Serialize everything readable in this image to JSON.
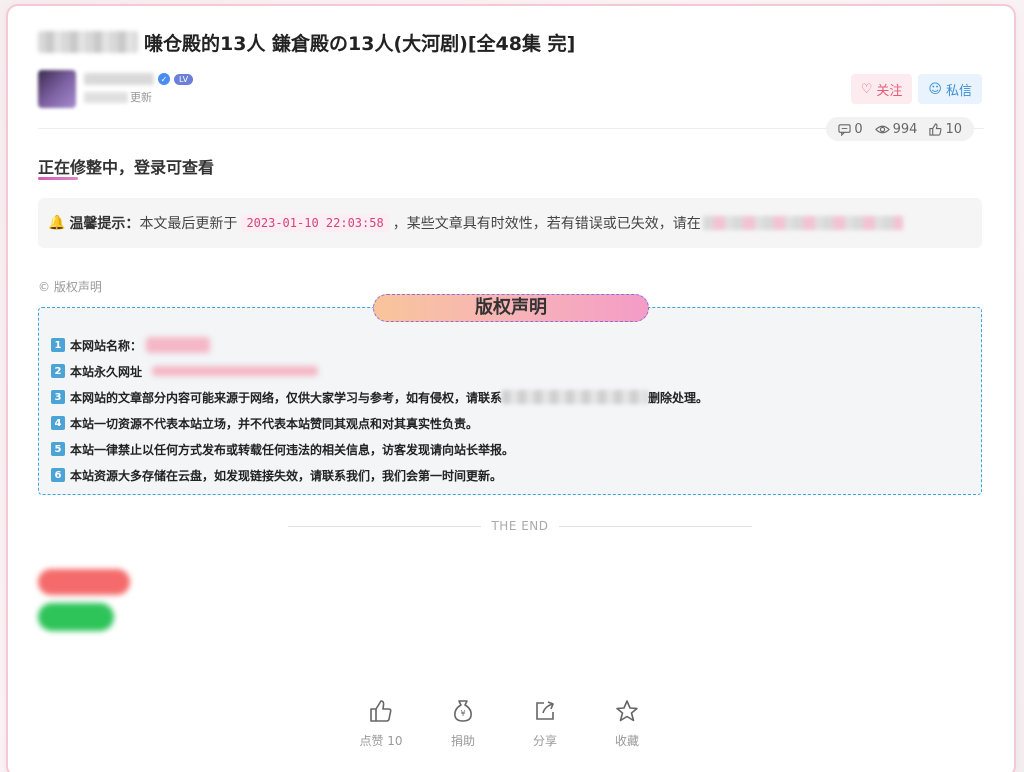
{
  "title": "嗛仓殿的13人 鎌倉殿の13人(大河剧)[全48集 完]",
  "author": {
    "level_badge": "LV",
    "update_suffix": "更新"
  },
  "actions": {
    "follow_label": "关注",
    "message_label": "私信"
  },
  "stats": {
    "comments": "0",
    "views": "994",
    "likes": "10"
  },
  "notice": "正在修整中，登录可查看",
  "tip": {
    "label": "温馨提示：",
    "prefix": "本文最后更新于",
    "date": "2023-01-10 22:03:58",
    "suffix": "，某些文章具有时效性，若有错误或已失效，请在"
  },
  "copyright_small": "© 版权声明",
  "copyright": {
    "header": "版权声明",
    "items": [
      {
        "num": "1",
        "text": "本网站名称："
      },
      {
        "num": "2",
        "text": "本站永久网址"
      },
      {
        "num": "3",
        "text": "本网站的文章部分内容可能来源于网络，仅供大家学习与参考，如有侵权，请联系",
        "tail": "删除处理。"
      },
      {
        "num": "4",
        "text": "本站一切资源不代表本站立场，并不代表本站赞同其观点和对其真实性负责。"
      },
      {
        "num": "5",
        "text": "本站一律禁止以任何方式发布或转载任何违法的相关信息，访客发现请向站长举报。"
      },
      {
        "num": "6",
        "text": "本站资源大多存储在云盘，如发现链接失效，请联系我们，我们会第一时间更新。"
      }
    ]
  },
  "end_text": "THE END",
  "bottom": {
    "like": "点赞 10",
    "donate": "捐助",
    "share": "分享",
    "favorite": "收藏"
  },
  "colors": {
    "accent_pink": "#e45c7a",
    "accent_blue": "#3a8fd6",
    "border_dashed": "#3aa6dd"
  }
}
